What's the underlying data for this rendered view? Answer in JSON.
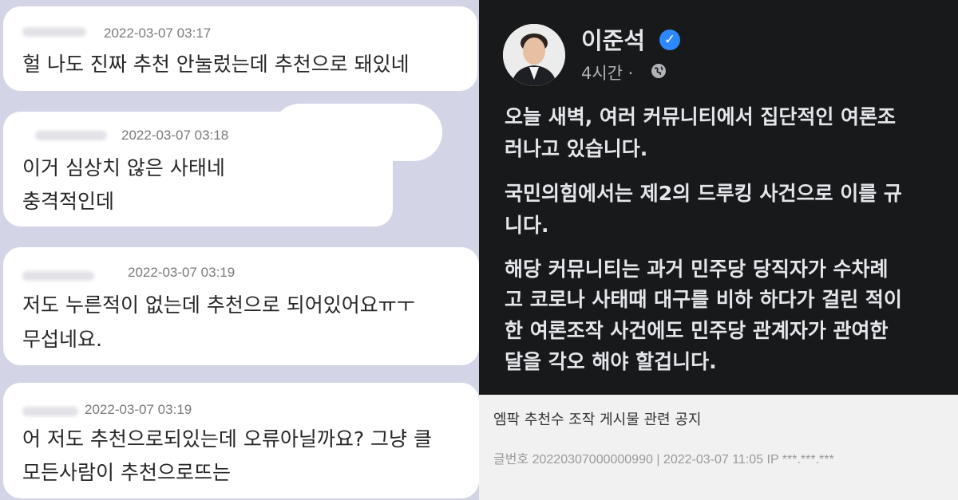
{
  "chat": {
    "messages": [
      {
        "timestamp": "2022-03-07 03:17",
        "lines": [
          "헐 나도 진짜 추천 안눌렀는데 추천으로 돼있네"
        ]
      },
      {
        "timestamp": "2022-03-07 03:18",
        "lines": [
          "이거 심상치 않은 사태네",
          "충격적인데"
        ]
      },
      {
        "timestamp": "2022-03-07 03:19",
        "lines": [
          "저도 누른적이 없는데 추천으로 되어있어요ㅠㅜ",
          "무섭네요."
        ]
      },
      {
        "timestamp": "2022-03-07 03:19",
        "lines": [
          "어 저도 추천으로되있는데 오류아닐까요? 그냥 클",
          "모든사람이 추천으로뜨는"
        ]
      }
    ]
  },
  "post": {
    "author": "이준석",
    "time": "4시간 ·",
    "verified_icon": "verified-check-icon",
    "privacy_icon": "globe-icon",
    "paragraphs": [
      [
        "오늘 새벽, 여러 커뮤니티에서 집단적인 여론조",
        "러나고 있습니다."
      ],
      [
        "국민의힘에서는 제2의 드루킹 사건으로 이를 규",
        "니다."
      ],
      [
        "해당 커뮤니티는 과거 민주당 당직자가 수차례",
        "고 코로나 사태때 대구를 비하 하다가 걸린 적이",
        "한 여론조작 사건에도 민주당 관계자가 관여한",
        "달을 각오 해야 할겁니다."
      ]
    ]
  },
  "notice": {
    "title": "엠팍 추천수 조작 게시물 관련 공지",
    "meta": "글번호 20220307000000990 | 2022-03-07 11:05     IP ***.***.***"
  },
  "colors": {
    "chat_background": "#d3d5e6",
    "bubble": "#ffffff",
    "facebook_dark": "#18191a",
    "verified_blue": "#2d88ff"
  }
}
